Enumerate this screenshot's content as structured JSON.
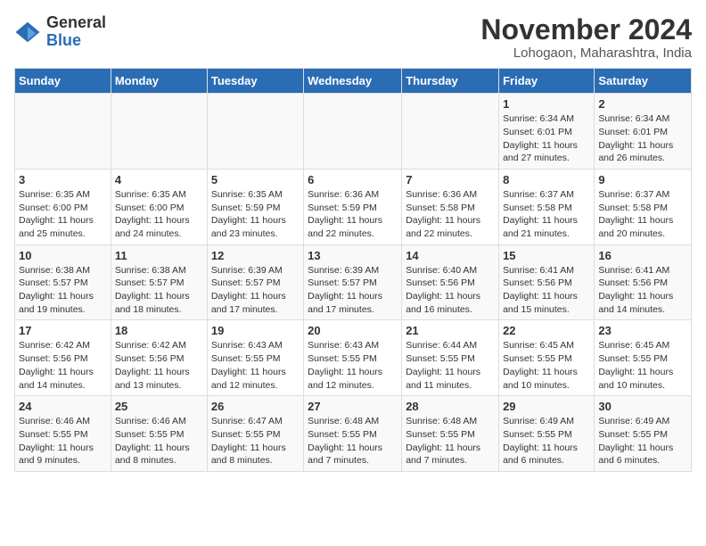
{
  "header": {
    "logo_general": "General",
    "logo_blue": "Blue",
    "month_title": "November 2024",
    "subtitle": "Lohogaon, Maharashtra, India"
  },
  "days_of_week": [
    "Sunday",
    "Monday",
    "Tuesday",
    "Wednesday",
    "Thursday",
    "Friday",
    "Saturday"
  ],
  "weeks": [
    [
      {
        "day": "",
        "info": ""
      },
      {
        "day": "",
        "info": ""
      },
      {
        "day": "",
        "info": ""
      },
      {
        "day": "",
        "info": ""
      },
      {
        "day": "",
        "info": ""
      },
      {
        "day": "1",
        "info": "Sunrise: 6:34 AM\nSunset: 6:01 PM\nDaylight: 11 hours and 27 minutes."
      },
      {
        "day": "2",
        "info": "Sunrise: 6:34 AM\nSunset: 6:01 PM\nDaylight: 11 hours and 26 minutes."
      }
    ],
    [
      {
        "day": "3",
        "info": "Sunrise: 6:35 AM\nSunset: 6:00 PM\nDaylight: 11 hours and 25 minutes."
      },
      {
        "day": "4",
        "info": "Sunrise: 6:35 AM\nSunset: 6:00 PM\nDaylight: 11 hours and 24 minutes."
      },
      {
        "day": "5",
        "info": "Sunrise: 6:35 AM\nSunset: 5:59 PM\nDaylight: 11 hours and 23 minutes."
      },
      {
        "day": "6",
        "info": "Sunrise: 6:36 AM\nSunset: 5:59 PM\nDaylight: 11 hours and 22 minutes."
      },
      {
        "day": "7",
        "info": "Sunrise: 6:36 AM\nSunset: 5:58 PM\nDaylight: 11 hours and 22 minutes."
      },
      {
        "day": "8",
        "info": "Sunrise: 6:37 AM\nSunset: 5:58 PM\nDaylight: 11 hours and 21 minutes."
      },
      {
        "day": "9",
        "info": "Sunrise: 6:37 AM\nSunset: 5:58 PM\nDaylight: 11 hours and 20 minutes."
      }
    ],
    [
      {
        "day": "10",
        "info": "Sunrise: 6:38 AM\nSunset: 5:57 PM\nDaylight: 11 hours and 19 minutes."
      },
      {
        "day": "11",
        "info": "Sunrise: 6:38 AM\nSunset: 5:57 PM\nDaylight: 11 hours and 18 minutes."
      },
      {
        "day": "12",
        "info": "Sunrise: 6:39 AM\nSunset: 5:57 PM\nDaylight: 11 hours and 17 minutes."
      },
      {
        "day": "13",
        "info": "Sunrise: 6:39 AM\nSunset: 5:57 PM\nDaylight: 11 hours and 17 minutes."
      },
      {
        "day": "14",
        "info": "Sunrise: 6:40 AM\nSunset: 5:56 PM\nDaylight: 11 hours and 16 minutes."
      },
      {
        "day": "15",
        "info": "Sunrise: 6:41 AM\nSunset: 5:56 PM\nDaylight: 11 hours and 15 minutes."
      },
      {
        "day": "16",
        "info": "Sunrise: 6:41 AM\nSunset: 5:56 PM\nDaylight: 11 hours and 14 minutes."
      }
    ],
    [
      {
        "day": "17",
        "info": "Sunrise: 6:42 AM\nSunset: 5:56 PM\nDaylight: 11 hours and 14 minutes."
      },
      {
        "day": "18",
        "info": "Sunrise: 6:42 AM\nSunset: 5:56 PM\nDaylight: 11 hours and 13 minutes."
      },
      {
        "day": "19",
        "info": "Sunrise: 6:43 AM\nSunset: 5:55 PM\nDaylight: 11 hours and 12 minutes."
      },
      {
        "day": "20",
        "info": "Sunrise: 6:43 AM\nSunset: 5:55 PM\nDaylight: 11 hours and 12 minutes."
      },
      {
        "day": "21",
        "info": "Sunrise: 6:44 AM\nSunset: 5:55 PM\nDaylight: 11 hours and 11 minutes."
      },
      {
        "day": "22",
        "info": "Sunrise: 6:45 AM\nSunset: 5:55 PM\nDaylight: 11 hours and 10 minutes."
      },
      {
        "day": "23",
        "info": "Sunrise: 6:45 AM\nSunset: 5:55 PM\nDaylight: 11 hours and 10 minutes."
      }
    ],
    [
      {
        "day": "24",
        "info": "Sunrise: 6:46 AM\nSunset: 5:55 PM\nDaylight: 11 hours and 9 minutes."
      },
      {
        "day": "25",
        "info": "Sunrise: 6:46 AM\nSunset: 5:55 PM\nDaylight: 11 hours and 8 minutes."
      },
      {
        "day": "26",
        "info": "Sunrise: 6:47 AM\nSunset: 5:55 PM\nDaylight: 11 hours and 8 minutes."
      },
      {
        "day": "27",
        "info": "Sunrise: 6:48 AM\nSunset: 5:55 PM\nDaylight: 11 hours and 7 minutes."
      },
      {
        "day": "28",
        "info": "Sunrise: 6:48 AM\nSunset: 5:55 PM\nDaylight: 11 hours and 7 minutes."
      },
      {
        "day": "29",
        "info": "Sunrise: 6:49 AM\nSunset: 5:55 PM\nDaylight: 11 hours and 6 minutes."
      },
      {
        "day": "30",
        "info": "Sunrise: 6:49 AM\nSunset: 5:55 PM\nDaylight: 11 hours and 6 minutes."
      }
    ]
  ]
}
